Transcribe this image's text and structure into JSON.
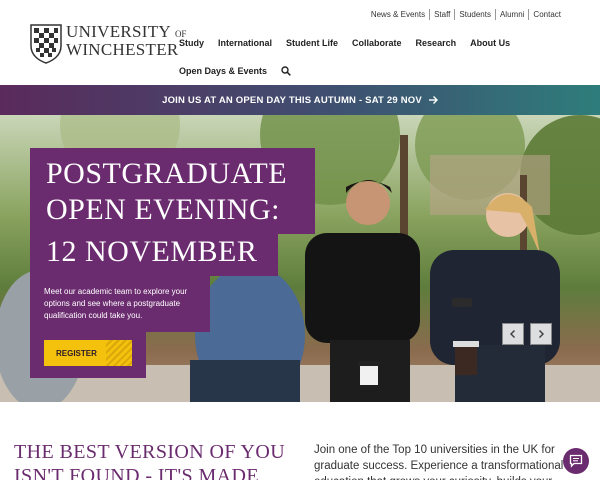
{
  "logo": {
    "line1": "UNIVERSITY",
    "line1_suffix": "OF",
    "line2": "WINCHESTER"
  },
  "utility_nav": [
    "News & Events",
    "Staff",
    "Students",
    "Alumni",
    "Contact"
  ],
  "main_nav": [
    "Study",
    "International",
    "Student Life",
    "Collaborate",
    "Research",
    "About Us"
  ],
  "sub_nav": {
    "label": "Open Days & Events",
    "search_icon": "search-icon"
  },
  "banner": {
    "text": "JOIN US AT AN OPEN DAY THIS AUTUMN - SAT 29 NOV",
    "icon": "arrow-right-icon"
  },
  "hero": {
    "title_line1": "POSTGRADUATE",
    "title_line2": "OPEN EVENING:",
    "title_line3": "12 NOVEMBER",
    "body": "Meet our academic team to explore your options and see where a postgraduate qualification could take you.",
    "cta": "REGISTER",
    "prev_icon": "chevron-left-icon",
    "next_icon": "chevron-right-icon"
  },
  "intro": {
    "heading": "THE BEST VERSION OF YOU ISN'T FOUND - IT'S MADE",
    "text": "Join one of the Top 10 universities in the UK for graduate success. Experience a transformational education that grows your curiosity, builds your"
  },
  "chat": {
    "icon": "chat-icon"
  },
  "colors": {
    "brand_purple": "#6b2b6f",
    "cta_yellow": "#f4c20d",
    "banner_start": "#5a2a5c",
    "banner_end": "#2e7d7b"
  }
}
